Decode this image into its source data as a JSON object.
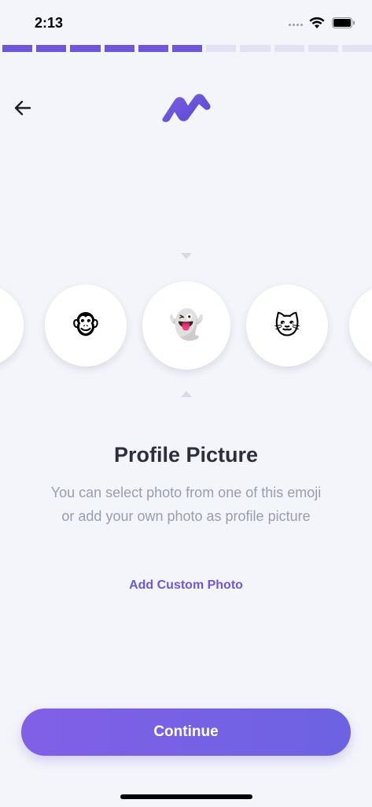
{
  "status_bar": {
    "time": "2:13",
    "icons": [
      "cellular-dots-icon",
      "wifi-icon",
      "battery-icon"
    ]
  },
  "progress": {
    "completed_steps": 6,
    "total_steps": 11,
    "active_color": "#6e58d9",
    "inactive_color": "#e3e2f4"
  },
  "header": {
    "back_icon": "arrow-left-icon",
    "logo_icon": "app-logo-icon"
  },
  "carousel": {
    "items": [
      {
        "emoji": "",
        "icon": "emoji-partial-left-icon",
        "selected": false
      },
      {
        "emoji": "🐵",
        "icon": "monkey-face-icon",
        "selected": false
      },
      {
        "emoji": "👻",
        "icon": "ghost-icon",
        "selected": true
      },
      {
        "emoji": "🐱",
        "icon": "cat-face-icon",
        "selected": false
      },
      {
        "emoji": "",
        "icon": "emoji-partial-right-icon",
        "selected": false
      }
    ]
  },
  "content": {
    "title": "Profile Picture",
    "description": "You can select photo from one of this emoji or add your own photo as profile picture",
    "add_custom_label": "Add Custom Photo"
  },
  "footer": {
    "continue_label": "Continue"
  },
  "colors": {
    "background": "#f4f5fa",
    "accent": "#6e58d9",
    "title": "#2d2f3e",
    "muted": "#9a9cb0"
  }
}
